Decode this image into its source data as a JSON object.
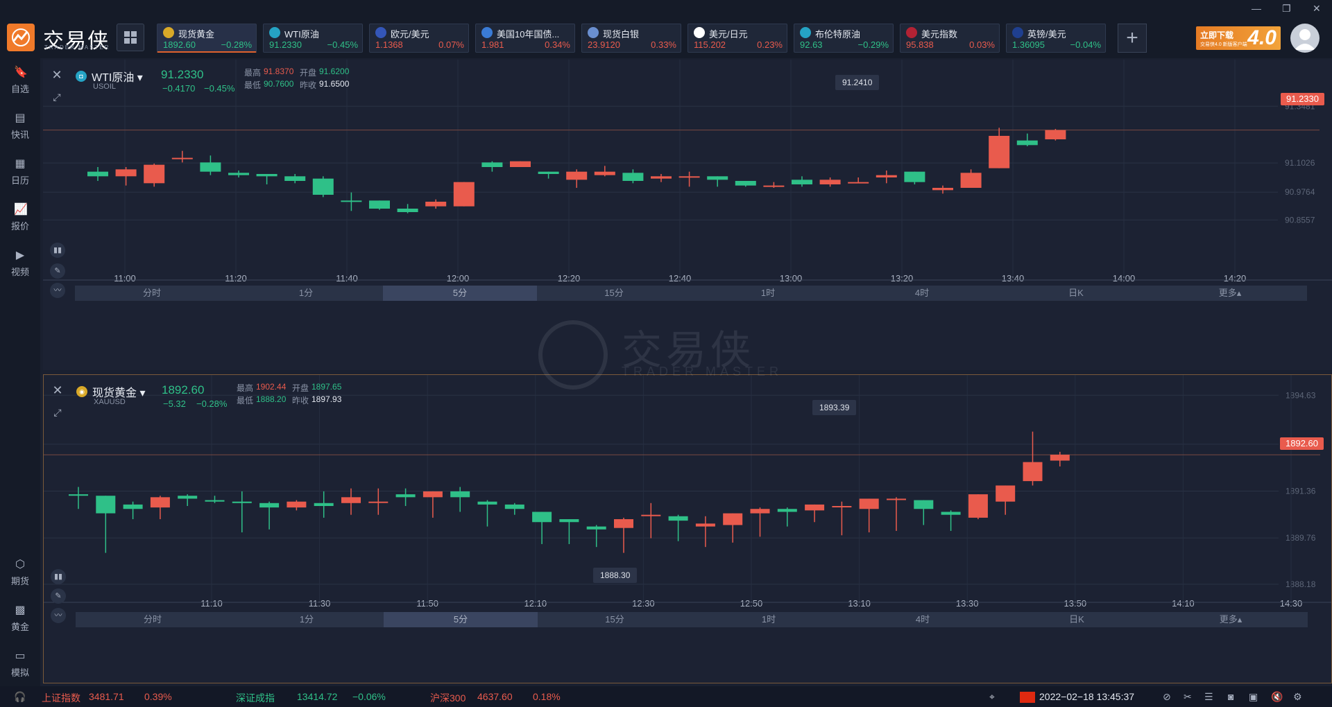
{
  "app": {
    "name": "交易侠",
    "sub": "TRADER MASTER"
  },
  "tickers": [
    {
      "name": "现货黄金",
      "price": "1892.60",
      "change": "−0.28%",
      "dir": "down",
      "icon": "gold-coin-icon",
      "color": "#d9a928",
      "active": true
    },
    {
      "name": "WTI原油",
      "price": "91.2330",
      "change": "−0.45%",
      "dir": "down",
      "icon": "oil-icon",
      "color": "#25a3c4",
      "active": true
    },
    {
      "name": "欧元/美元",
      "price": "1.1368",
      "change": "0.07%",
      "dir": "up",
      "icon": "eu-flag-icon",
      "color": "#3456b8",
      "active": false
    },
    {
      "name": "美国10年国债...",
      "price": "1.981",
      "change": "0.34%",
      "dir": "up",
      "icon": "bar-chart-icon",
      "color": "#3a7bd5",
      "active": false
    },
    {
      "name": "现货白银",
      "price": "23.9120",
      "change": "0.33%",
      "dir": "up",
      "icon": "silver-coin-icon",
      "color": "#6a8fd0",
      "active": false
    },
    {
      "name": "美元/日元",
      "price": "115.202",
      "change": "0.23%",
      "dir": "up",
      "icon": "jp-flag-icon",
      "color": "#ffffff",
      "active": false
    },
    {
      "name": "布伦特原油",
      "price": "92.63",
      "change": "−0.29%",
      "dir": "down",
      "icon": "oil-icon",
      "color": "#25a3c4",
      "active": false
    },
    {
      "name": "美元指数",
      "price": "95.838",
      "change": "0.03%",
      "dir": "up",
      "icon": "us-flag-icon",
      "color": "#b22234",
      "active": false
    },
    {
      "name": "英镑/美元",
      "price": "1.36095",
      "change": "−0.04%",
      "dir": "down",
      "icon": "uk-flag-icon",
      "color": "#1f3f8f",
      "active": false
    }
  ],
  "promo": {
    "title": "立即下载",
    "sub": "交易侠4.0 新版客户端",
    "version": "4.0"
  },
  "sidebar": {
    "top": [
      {
        "label": "自选",
        "icon": "bookmark-plus-icon"
      },
      {
        "label": "快讯",
        "icon": "news-icon"
      },
      {
        "label": "日历",
        "icon": "calendar-icon"
      },
      {
        "label": "报价",
        "icon": "quote-chart-icon"
      },
      {
        "label": "视频",
        "icon": "video-icon"
      }
    ],
    "bottom": [
      {
        "label": "期货",
        "icon": "futures-icon"
      },
      {
        "label": "黄金",
        "icon": "gold-icon"
      },
      {
        "label": "模拟",
        "icon": "wallet-icon"
      }
    ]
  },
  "labels": {
    "high": "最高",
    "open": "开盘",
    "low": "最低",
    "prev": "昨收"
  },
  "timeframes": [
    "分时",
    "1分",
    "5分",
    "15分",
    "1时",
    "4时",
    "日K",
    "更多▴"
  ],
  "selected_tf": 2,
  "wti": {
    "name": "WTI原油",
    "code": "USOIL",
    "price": "91.2330",
    "change": "−0.4170",
    "change_pct": "−0.45%",
    "high": "91.8370",
    "open": "91.6200",
    "low": "90.7600",
    "prev": "91.6500",
    "tag": "91.2330",
    "hl_label": "91.2410"
  },
  "gold": {
    "name": "现货黄金",
    "code": "XAUUSD",
    "price": "1892.60",
    "change": "−5.32",
    "change_pct": "−0.28%",
    "high": "1902.44",
    "open": "1897.65",
    "low": "1888.20",
    "prev": "1897.93",
    "tag": "1892.60",
    "hl_high": "1893.39",
    "hl_low": "1888.30"
  },
  "chart_data": [
    {
      "type": "candlestick",
      "symbol": "USOIL",
      "ylim": [
        90.62,
        91.46
      ],
      "y_ticks": [
        "91.3481",
        "91.1026",
        "90.9764",
        "90.8557"
      ],
      "x_ticks": [
        "11:00",
        "11:20",
        "11:40",
        "12:00",
        "12:20",
        "12:40",
        "13:00",
        "13:20",
        "13:40",
        "14:00",
        "14:20"
      ],
      "candles": [
        [
          91.065,
          91.045,
          91.085,
          91.025
        ],
        [
          91.045,
          91.075,
          91.085,
          91.005
        ],
        [
          91.015,
          91.095,
          91.1,
          91.0
        ],
        [
          91.12,
          91.125,
          91.155,
          91.105
        ],
        [
          91.105,
          91.065,
          91.135,
          91.05
        ],
        [
          91.06,
          91.05,
          91.07,
          91.04
        ],
        [
          91.055,
          91.045,
          91.055,
          91.01
        ],
        [
          91.045,
          91.025,
          91.055,
          91.015
        ],
        [
          91.035,
          90.965,
          91.045,
          90.955
        ],
        [
          90.94,
          90.935,
          90.975,
          90.895
        ],
        [
          90.94,
          90.905,
          90.94,
          90.9
        ],
        [
          90.905,
          90.89,
          90.925,
          90.885
        ],
        [
          90.915,
          90.935,
          90.945,
          90.905
        ],
        [
          90.915,
          91.02,
          91.02,
          90.915
        ],
        [
          91.105,
          91.085,
          91.11,
          91.065
        ],
        [
          91.085,
          91.11,
          91.11,
          91.085
        ],
        [
          91.065,
          91.055,
          91.065,
          91.035
        ],
        [
          91.03,
          91.065,
          91.075,
          90.995
        ],
        [
          91.05,
          91.065,
          91.09,
          91.045
        ],
        [
          91.06,
          91.025,
          91.075,
          91.015
        ],
        [
          91.035,
          91.045,
          91.055,
          91.02
        ],
        [
          91.04,
          91.045,
          91.065,
          91.0
        ],
        [
          91.045,
          91.03,
          91.045,
          91.0
        ],
        [
          91.025,
          91.005,
          91.025,
          91.0
        ],
        [
          91.0,
          91.005,
          91.02,
          90.995
        ],
        [
          91.03,
          91.01,
          91.045,
          91.0
        ],
        [
          91.01,
          91.03,
          91.04,
          91.0
        ],
        [
          91.02,
          91.02,
          91.04,
          91.015
        ],
        [
          91.04,
          91.05,
          91.07,
          91.015
        ],
        [
          91.065,
          91.02,
          91.065,
          91.01
        ],
        [
          90.985,
          90.995,
          91.005,
          90.97
        ],
        [
          90.995,
          91.06,
          91.075,
          90.995
        ],
        [
          91.08,
          91.22,
          91.255,
          91.08
        ],
        [
          91.2,
          91.18,
          91.23,
          91.175
        ],
        [
          91.205,
          91.245,
          91.25,
          91.2
        ]
      ]
    },
    {
      "type": "candlestick",
      "symbol": "XAUUSD",
      "ylim": [
        1887.75,
        1894.85
      ],
      "y_ticks": [
        "1894.63",
        "1892.96",
        "1891.36",
        "1889.76",
        "1888.18"
      ],
      "x_ticks": [
        "11:10",
        "11:30",
        "11:50",
        "12:10",
        "12:30",
        "12:50",
        "13:10",
        "13:30",
        "13:50",
        "14:10",
        "14:30"
      ],
      "candles": [
        [
          1891.25,
          1891.2,
          1891.5,
          1890.75
        ],
        [
          1891.2,
          1890.6,
          1891.2,
          1889.25
        ],
        [
          1890.9,
          1890.75,
          1891.0,
          1890.4
        ],
        [
          1890.8,
          1891.15,
          1891.2,
          1890.4
        ],
        [
          1891.2,
          1891.1,
          1891.25,
          1890.85
        ],
        [
          1891.05,
          1891.0,
          1891.2,
          1890.95
        ],
        [
          1891.0,
          1890.95,
          1891.35,
          1889.95
        ],
        [
          1890.95,
          1890.8,
          1891.0,
          1890.05
        ],
        [
          1890.8,
          1891.0,
          1891.05,
          1890.7
        ],
        [
          1890.95,
          1890.85,
          1891.35,
          1890.45
        ],
        [
          1890.95,
          1891.15,
          1891.45,
          1890.55
        ],
        [
          1891.0,
          1891.0,
          1891.45,
          1890.55
        ],
        [
          1891.25,
          1891.15,
          1891.45,
          1890.85
        ],
        [
          1891.15,
          1891.35,
          1891.35,
          1890.45
        ],
        [
          1891.35,
          1891.15,
          1891.5,
          1890.65
        ],
        [
          1891.0,
          1890.9,
          1891.05,
          1890.15
        ],
        [
          1890.9,
          1890.75,
          1890.95,
          1890.55
        ],
        [
          1890.65,
          1890.3,
          1890.65,
          1889.55
        ],
        [
          1890.4,
          1890.3,
          1890.4,
          1889.55
        ],
        [
          1890.15,
          1890.05,
          1890.2,
          1889.45
        ],
        [
          1890.1,
          1890.4,
          1890.45,
          1889.25
        ],
        [
          1890.55,
          1890.55,
          1890.95,
          1889.75
        ],
        [
          1890.5,
          1890.35,
          1890.55,
          1889.65
        ],
        [
          1890.15,
          1890.25,
          1890.5,
          1889.45
        ],
        [
          1890.2,
          1890.6,
          1890.6,
          1889.6
        ],
        [
          1890.6,
          1890.75,
          1890.8,
          1889.8
        ],
        [
          1890.75,
          1890.65,
          1890.8,
          1890.15
        ],
        [
          1890.7,
          1890.9,
          1890.9,
          1890.3
        ],
        [
          1890.85,
          1890.85,
          1891.0,
          1889.85
        ],
        [
          1890.75,
          1891.1,
          1891.1,
          1889.95
        ],
        [
          1891.1,
          1891.1,
          1891.15,
          1890.0
        ],
        [
          1891.05,
          1890.75,
          1891.05,
          1890.2
        ],
        [
          1890.65,
          1890.55,
          1890.7,
          1890.0
        ],
        [
          1890.45,
          1891.25,
          1891.25,
          1890.4
        ],
        [
          1891.0,
          1891.55,
          1891.55,
          1890.55
        ],
        [
          1891.7,
          1892.35,
          1893.39,
          1891.55
        ],
        [
          1892.4,
          1892.6,
          1892.7,
          1892.2
        ]
      ]
    }
  ],
  "status": {
    "indices": [
      {
        "name": "上证指数",
        "value": "3481.71",
        "change": "0.39%",
        "dir": "up"
      },
      {
        "name": "深证成指",
        "value": "13414.72",
        "change": "−0.06%",
        "dir": "down"
      },
      {
        "name": "沪深300",
        "value": "4637.60",
        "change": "0.18%",
        "dir": "up"
      }
    ],
    "datetime": "2022−02−18 13:45:37"
  },
  "watermark": {
    "text": "交易侠",
    "sub": "TRADER MASTER"
  }
}
